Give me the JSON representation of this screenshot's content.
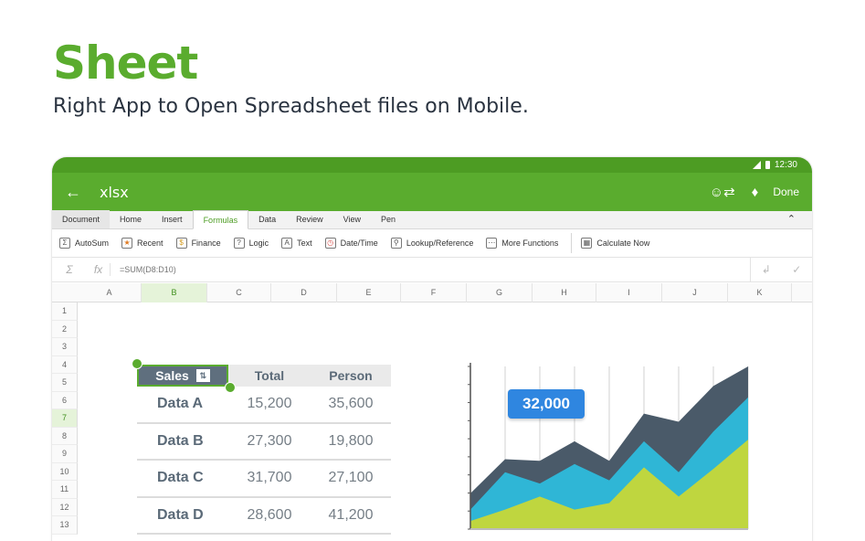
{
  "hero": {
    "title": "Sheet",
    "subtitle": "Right App to Open Spreadsheet files on Mobile."
  },
  "status_bar": {
    "time": "12:30"
  },
  "app_bar": {
    "back_icon": "arrow-left-icon",
    "title": "xlsx",
    "done_label": "Done"
  },
  "tabs": [
    {
      "label": "Document"
    },
    {
      "label": "Home"
    },
    {
      "label": "Insert"
    },
    {
      "label": "Formulas",
      "active": true
    },
    {
      "label": "Data"
    },
    {
      "label": "Review"
    },
    {
      "label": "View"
    },
    {
      "label": "Pen"
    }
  ],
  "ribbon": [
    {
      "label": "AutoSum",
      "icon": "autosum-icon"
    },
    {
      "label": "Recent",
      "icon": "recent-icon"
    },
    {
      "label": "Finance",
      "icon": "finance-icon"
    },
    {
      "label": "Logic",
      "icon": "logic-icon"
    },
    {
      "label": "Text",
      "icon": "text-icon"
    },
    {
      "label": "Date/Time",
      "icon": "datetime-icon"
    },
    {
      "label": "Lookup/Reference",
      "icon": "lookup-icon"
    },
    {
      "label": "More Functions",
      "icon": "more-functions-icon"
    },
    {
      "label": "Calculate Now",
      "icon": "calculate-icon"
    }
  ],
  "formula_bar": {
    "formula": "=SUM(D8:D10)"
  },
  "columns": [
    "A",
    "B",
    "C",
    "D",
    "E",
    "F",
    "G",
    "H",
    "I",
    "J",
    "K"
  ],
  "selected_column": "B",
  "rows": [
    "1",
    "2",
    "3",
    "4",
    "5",
    "6",
    "7",
    "8",
    "9",
    "10",
    "11",
    "12",
    "13"
  ],
  "selected_row": "7",
  "table": {
    "headers": [
      "Sales",
      "Total",
      "Person"
    ],
    "rows": [
      {
        "name": "Data A",
        "total": "15,200",
        "person": "35,600"
      },
      {
        "name": "Data B",
        "total": "27,300",
        "person": "19,800"
      },
      {
        "name": "Data C",
        "total": "31,700",
        "person": "27,100"
      },
      {
        "name": "Data D",
        "total": "28,600",
        "person": "41,200"
      }
    ]
  },
  "chart_data": {
    "type": "area",
    "callout": "32,000",
    "x": [
      0,
      1,
      2,
      3,
      4,
      5,
      6,
      7,
      8
    ],
    "series": [
      {
        "color": "#4a5a69",
        "values": [
          0.22,
          0.43,
          0.42,
          0.54,
          0.42,
          0.71,
          0.66,
          0.88,
          1.0
        ]
      },
      {
        "color": "#2fb6d6",
        "values": [
          0.12,
          0.35,
          0.28,
          0.4,
          0.3,
          0.54,
          0.35,
          0.6,
          0.81
        ]
      },
      {
        "color": "#bfd63f",
        "values": [
          0.05,
          0.12,
          0.2,
          0.12,
          0.16,
          0.38,
          0.2,
          0.37,
          0.55
        ]
      }
    ],
    "colors": {
      "grid": "#e8e8e8",
      "axis": "#555555"
    }
  },
  "colors": {
    "brand": "#5aac2e",
    "brand_dark": "#4d9c23",
    "callout": "#2f86e0"
  }
}
